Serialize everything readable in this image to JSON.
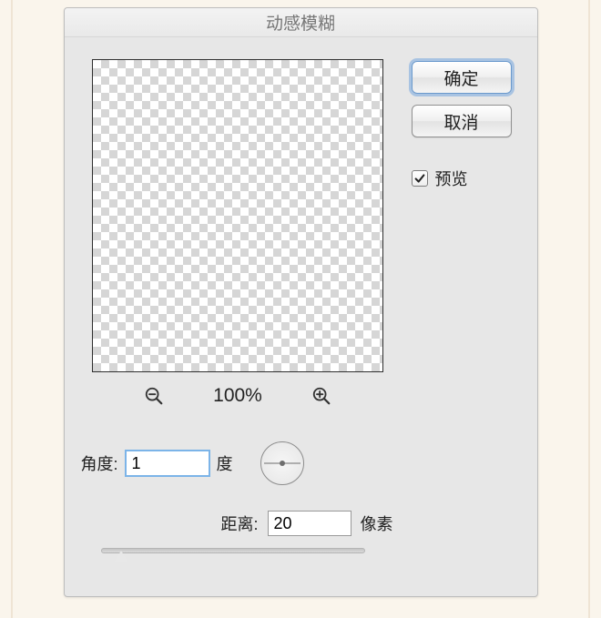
{
  "dialog": {
    "title": "动感模糊"
  },
  "buttons": {
    "ok": "确定",
    "cancel": "取消"
  },
  "preview_checkbox": {
    "label": "预览",
    "checked": true
  },
  "zoom": {
    "level": "100%"
  },
  "angle": {
    "label": "角度:",
    "value": "1",
    "unit": "度"
  },
  "distance": {
    "label": "距离:",
    "value": "20",
    "unit": "像素"
  }
}
